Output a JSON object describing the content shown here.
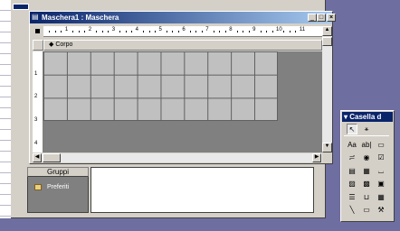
{
  "window": {
    "title": "Maschera1 : Maschera",
    "buttons": {
      "minimize": "_",
      "maximize": "□",
      "close": "×"
    }
  },
  "ruler": {
    "marks": [
      "1",
      "2",
      "3",
      "4",
      "5",
      "6",
      "7",
      "8",
      "9",
      "10",
      "11"
    ]
  },
  "vruler": {
    "marks": [
      "1",
      "2",
      "3",
      "4"
    ]
  },
  "section": {
    "label": "Corpo"
  },
  "sidebar": {
    "groups_label": "Gruppi",
    "favorites_label": "Preferiti"
  },
  "toolbox": {
    "title": "Casella d",
    "tools": [
      {
        "icon": "select-arrow-icon",
        "glyph": "↖"
      },
      {
        "icon": "wizard-wand-icon",
        "glyph": "⚹"
      },
      {
        "icon": "label-icon",
        "glyph": "Aa"
      },
      {
        "icon": "textbox-icon",
        "glyph": "ab|"
      },
      {
        "icon": "option-group-icon",
        "glyph": "▭"
      },
      {
        "icon": "toggle-button-icon",
        "glyph": "≓"
      },
      {
        "icon": "option-button-icon",
        "glyph": "◉"
      },
      {
        "icon": "checkbox-icon",
        "glyph": "☑"
      },
      {
        "icon": "combo-box-icon",
        "glyph": "▤"
      },
      {
        "icon": "list-box-icon",
        "glyph": "▦"
      },
      {
        "icon": "command-button-icon",
        "glyph": "⌴"
      },
      {
        "icon": "image-icon",
        "glyph": "▨"
      },
      {
        "icon": "unbound-object-icon",
        "glyph": "▩"
      },
      {
        "icon": "bound-object-icon",
        "glyph": "▣"
      },
      {
        "icon": "page-break-icon",
        "glyph": "☰"
      },
      {
        "icon": "tab-control-icon",
        "glyph": "⊔"
      },
      {
        "icon": "subform-icon",
        "glyph": "▦"
      },
      {
        "icon": "line-icon",
        "glyph": "╲"
      },
      {
        "icon": "rectangle-icon",
        "glyph": "▭"
      },
      {
        "icon": "more-controls-icon",
        "glyph": "⚒"
      }
    ]
  }
}
